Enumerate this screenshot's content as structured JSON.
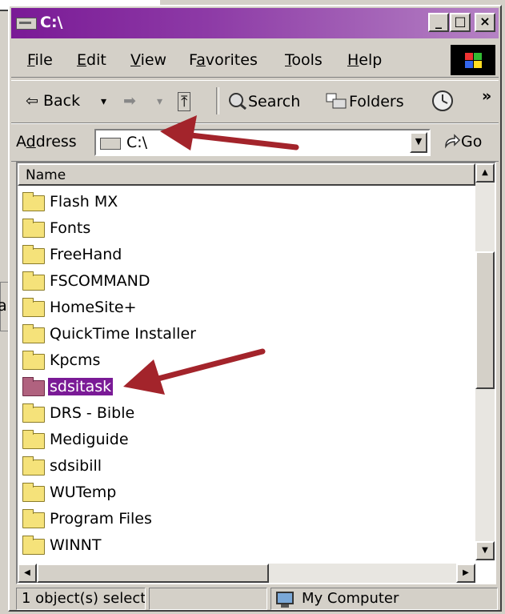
{
  "window": {
    "title": "C:\\"
  },
  "titlebar_buttons": {
    "minimize": "_",
    "maximize": "□",
    "close": "×"
  },
  "menu": [
    {
      "label": "File",
      "key": "F",
      "rest": "ile"
    },
    {
      "label": "Edit",
      "key": "E",
      "rest": "dit"
    },
    {
      "label": "View",
      "key": "V",
      "rest": "iew"
    },
    {
      "label": "Favorites",
      "key": "a",
      "pre": "F",
      "rest": "vorites"
    },
    {
      "label": "Tools",
      "key": "T",
      "rest": "ools"
    },
    {
      "label": "Help",
      "key": "H",
      "rest": "elp"
    }
  ],
  "toolbar": {
    "back": "⇦ Back",
    "back_drop": "▾",
    "forward": "➡",
    "forward_drop": "▾",
    "up": "⤒",
    "search": "Search",
    "folders": "Folders",
    "more": "»"
  },
  "address": {
    "label_pre": "A",
    "label_key": "d",
    "label_rest": "dress",
    "value": "C:\\",
    "go": "Go"
  },
  "listview": {
    "column": "Name",
    "items": [
      {
        "name": "Flash MX",
        "selected": false
      },
      {
        "name": "Fonts",
        "selected": false
      },
      {
        "name": "FreeHand",
        "selected": false
      },
      {
        "name": "FSCOMMAND",
        "selected": false
      },
      {
        "name": "HomeSite+",
        "selected": false
      },
      {
        "name": "QuickTime Installer",
        "selected": false
      },
      {
        "name": "Kpcms",
        "selected": false
      },
      {
        "name": "sdsitask",
        "selected": true
      },
      {
        "name": "DRS - Bible",
        "selected": false
      },
      {
        "name": "Mediguide",
        "selected": false
      },
      {
        "name": "sdsibill",
        "selected": false
      },
      {
        "name": "WUTemp",
        "selected": false
      },
      {
        "name": "Program Files",
        "selected": false
      },
      {
        "name": "WINNT",
        "selected": false
      }
    ]
  },
  "status": {
    "selection": "1 object(s) select",
    "zone": "My Computer"
  },
  "background": {
    "left_fragment": "a"
  },
  "colors": {
    "title_start": "#7a1a96",
    "title_end": "#b582c4",
    "selection": "#7a1a96",
    "arrow": "#a3242b"
  }
}
